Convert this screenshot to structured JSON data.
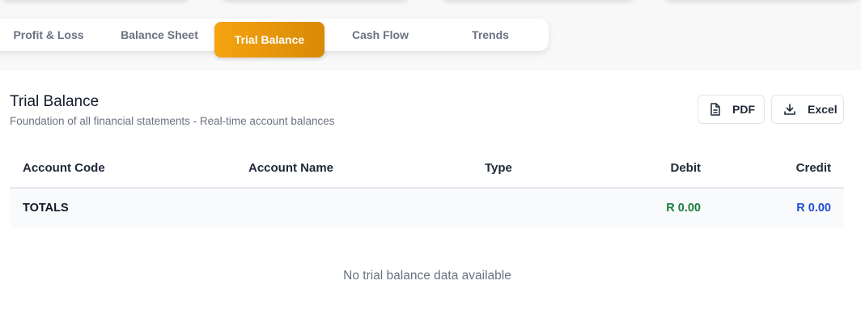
{
  "tabs": [
    {
      "label": "Profit & Loss",
      "active": false
    },
    {
      "label": "Balance Sheet",
      "active": false
    },
    {
      "label": "Trial Balance",
      "active": true
    },
    {
      "label": "Cash Flow",
      "active": false
    },
    {
      "label": "Trends",
      "active": false
    }
  ],
  "section": {
    "title": "Trial Balance",
    "subtitle": "Foundation of all financial statements - Real-time account balances"
  },
  "actions": {
    "pdf_label": "PDF",
    "pdf_icon": "document-icon",
    "excel_label": "Excel",
    "excel_icon": "download-icon"
  },
  "table": {
    "columns": [
      "Account Code",
      "Account Name",
      "Type",
      "Debit",
      "Credit"
    ],
    "totals": {
      "label": "TOTALS",
      "debit": "R 0.00",
      "credit": "R 0.00"
    },
    "empty_message": "No trial balance data available"
  },
  "colors": {
    "accent": "#f5a30f",
    "debit": "#15803d",
    "credit": "#1d4ed8"
  }
}
